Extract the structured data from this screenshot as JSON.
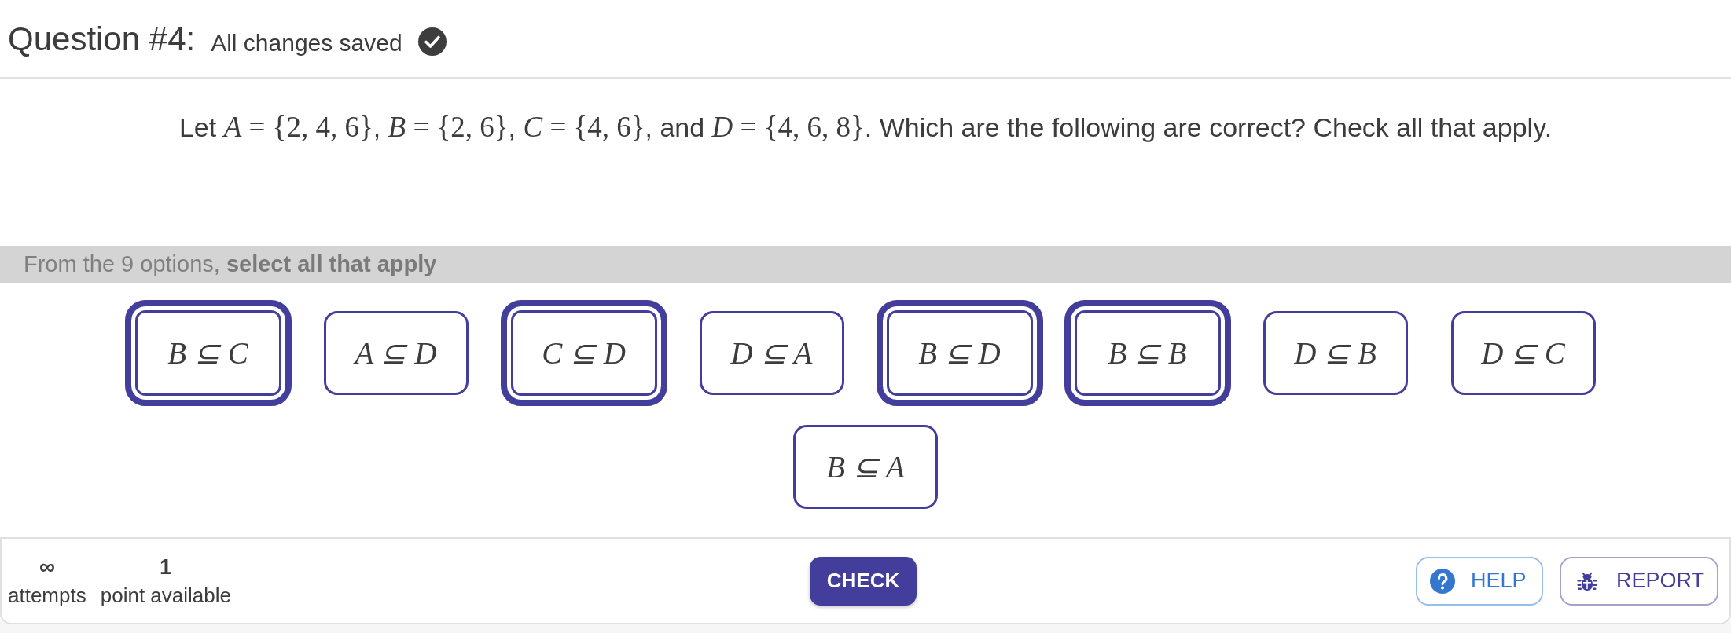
{
  "header": {
    "title": "Question #4:",
    "save_status": "All changes saved"
  },
  "prompt": [
    {
      "kind": "text",
      "text": "Let "
    },
    {
      "kind": "math",
      "text": "*A* = {2, 4, 6}"
    },
    {
      "kind": "text",
      "text": ", "
    },
    {
      "kind": "math",
      "text": "*B* = {2, 6}"
    },
    {
      "kind": "text",
      "text": ", "
    },
    {
      "kind": "math",
      "text": "*C* = {4, 6}"
    },
    {
      "kind": "text",
      "text": ", and "
    },
    {
      "kind": "math",
      "text": "*D* = {4, 6, 8}"
    },
    {
      "kind": "text",
      "text": ". Which are the following are correct? Check all that apply."
    }
  ],
  "instructions": "From the 9 options, **select all that apply**",
  "options": [
    {
      "label": "B ⊆ C",
      "selected": true
    },
    {
      "label": "A ⊆ D",
      "selected": false
    },
    {
      "label": "C ⊆ D",
      "selected": true
    },
    {
      "label": "D ⊆ A",
      "selected": false
    },
    {
      "label": "B ⊆ D",
      "selected": true
    },
    {
      "label": "B ⊆ B",
      "selected": true
    },
    {
      "label": "D ⊆ B",
      "selected": false
    },
    {
      "label": "D ⊆ C",
      "selected": false
    },
    {
      "label": "B ⊆ A",
      "selected": false
    }
  ],
  "footer": {
    "stats": [
      {
        "value": "∞",
        "label": "attempts"
      },
      {
        "value": "1",
        "label": "point available"
      }
    ],
    "check_button": "CHECK",
    "help_button": "HELP",
    "report_button": "REPORT"
  }
}
